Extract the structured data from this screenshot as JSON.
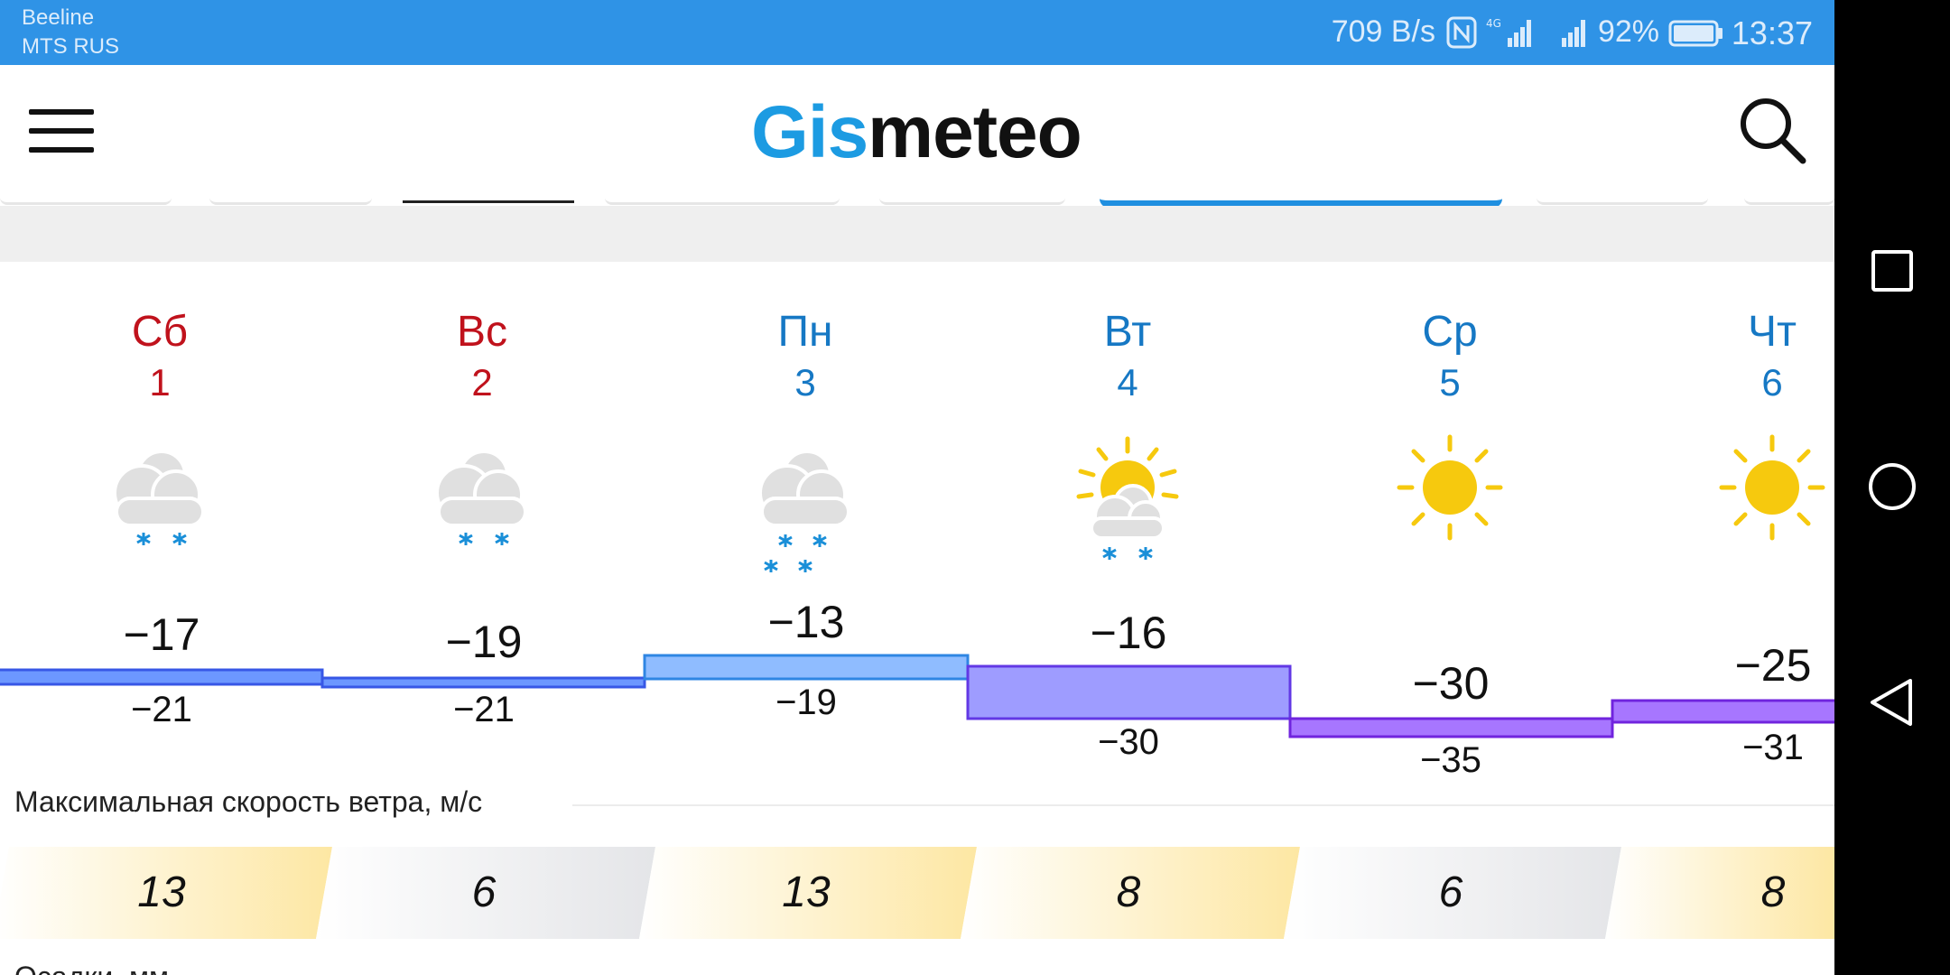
{
  "status_bar": {
    "carrier_1": "Beeline",
    "carrier_2": "MTS RUS",
    "net_speed": "709 B/s",
    "battery": "92%",
    "time": "13:37",
    "icons": [
      "nfc-icon",
      "signal-4g-icon",
      "signal-icon",
      "battery-icon"
    ]
  },
  "app_bar": {
    "logo_part_1": "Gis",
    "logo_part_2": "meteo",
    "icons": [
      "menu-icon",
      "search-icon"
    ],
    "brand_color": "#1c9be2"
  },
  "forecast": {
    "days": [
      {
        "name": "Сб",
        "date": "1",
        "weekend": true,
        "icon": "cloud-snow-icon",
        "t_max": "−17",
        "t_min": "−21",
        "wind": "13"
      },
      {
        "name": "Вс",
        "date": "2",
        "weekend": true,
        "icon": "cloud-snow-icon",
        "t_max": "−19",
        "t_min": "−21",
        "wind": "6"
      },
      {
        "name": "Пн",
        "date": "3",
        "weekend": false,
        "icon": "cloud-heavy-snow-icon",
        "t_max": "−13",
        "t_min": "−19",
        "wind": "13"
      },
      {
        "name": "Вт",
        "date": "4",
        "weekend": false,
        "icon": "partly-sunny-snow-icon",
        "t_max": "−16",
        "t_min": "−30",
        "wind": "8"
      },
      {
        "name": "Ср",
        "date": "5",
        "weekend": false,
        "icon": "sun-icon",
        "t_max": "−30",
        "t_min": "−35",
        "wind": "6"
      },
      {
        "name": "Чт",
        "date": "6",
        "weekend": false,
        "icon": "sun-icon",
        "t_max": "−25",
        "t_min": "−31",
        "wind": "8"
      }
    ],
    "colors": {
      "weekend": "#c0121c",
      "weekday": "#1678c4"
    }
  },
  "wind": {
    "title": "Максимальная скорость ветра, м/с"
  },
  "precipitation": {
    "title": "Осадки, мм"
  },
  "nav_bar": {
    "icons": [
      "recent-apps-icon",
      "home-icon",
      "back-icon"
    ]
  }
}
